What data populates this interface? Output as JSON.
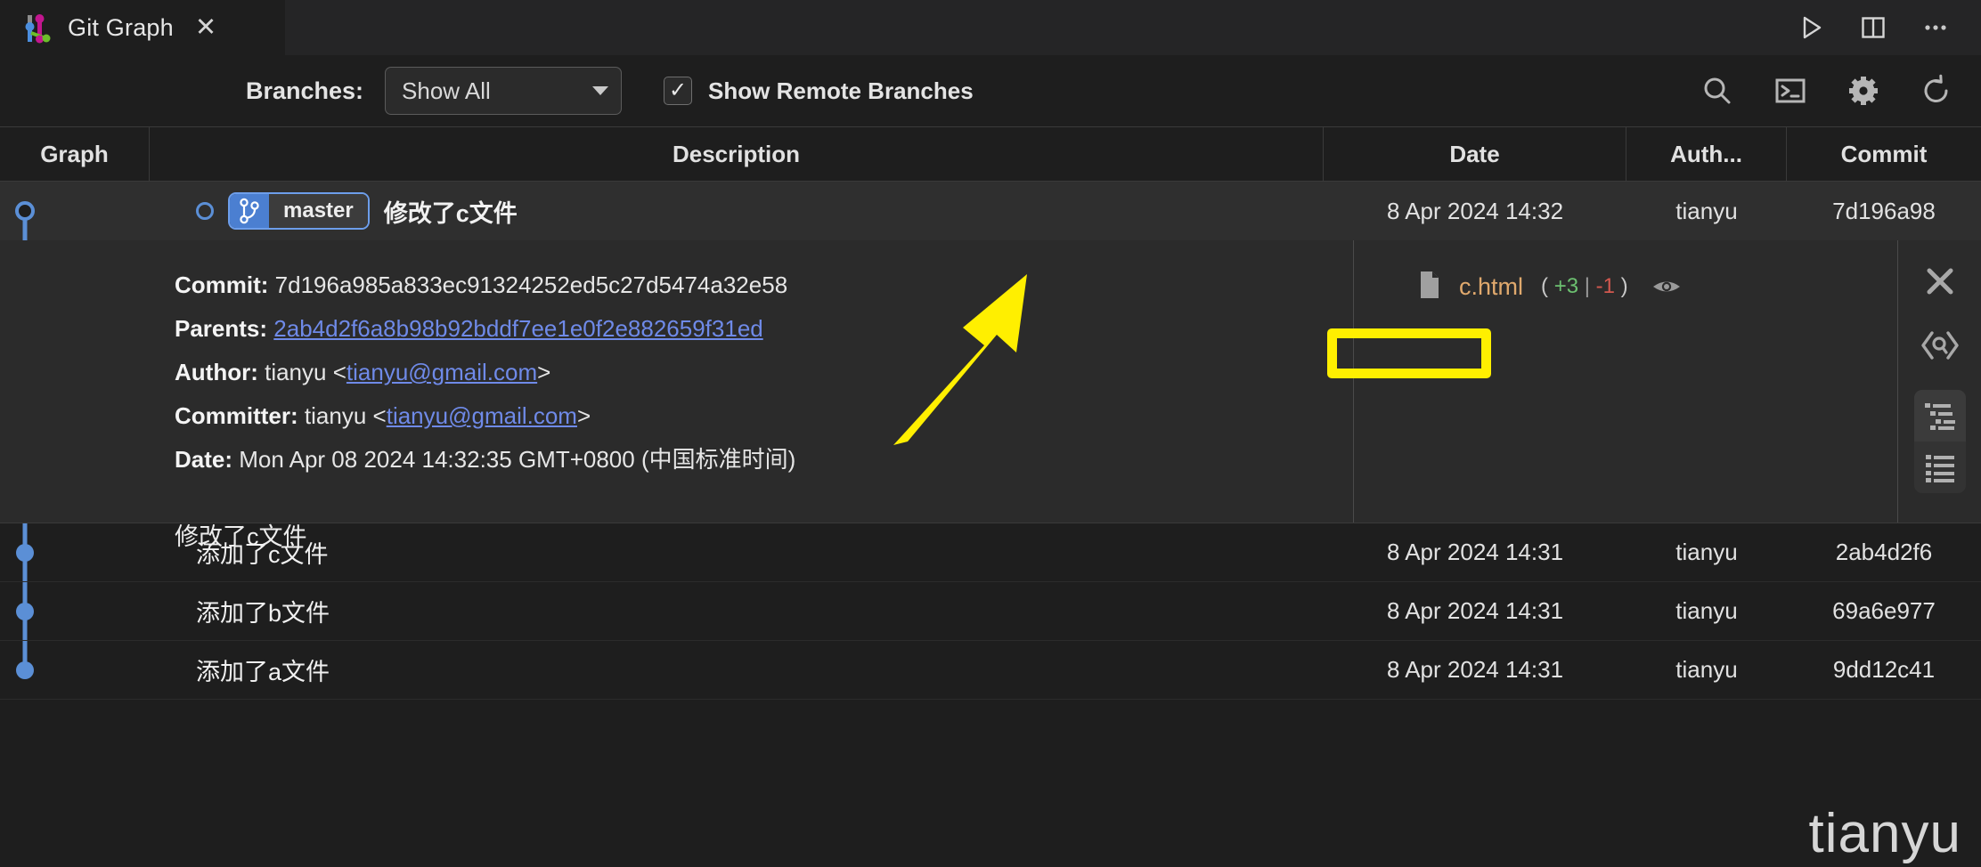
{
  "window": {
    "tab_title": "Git Graph",
    "tab_close_glyph": "✕",
    "actions": [
      {
        "name": "run-icon",
        "label": "Run"
      },
      {
        "name": "split-editor-icon",
        "label": "Split Editor"
      },
      {
        "name": "more-actions-icon",
        "label": "More Actions..."
      }
    ]
  },
  "toolbar": {
    "branches_label": "Branches:",
    "branch_selected": "Show All",
    "show_remote_label": "Show Remote Branches",
    "show_remote_checked": true,
    "checkmark": "✓",
    "actions": [
      {
        "name": "search-icon",
        "label": "Search"
      },
      {
        "name": "terminal-icon",
        "label": "Terminal"
      },
      {
        "name": "gear-icon",
        "label": "Settings"
      },
      {
        "name": "refresh-icon",
        "label": "Refresh"
      }
    ]
  },
  "table": {
    "headers": {
      "graph": "Graph",
      "description": "Description",
      "date": "Date",
      "author": "Auth...",
      "commit": "Commit"
    },
    "rows": [
      {
        "branch_badge": "master",
        "description": "修改了c文件",
        "date": "8 Apr 2024 14:32",
        "author": "tianyu",
        "commit": "7d196a98",
        "selected": true
      },
      {
        "branch_badge": "",
        "description": "添加了c文件",
        "date": "8 Apr 2024 14:31",
        "author": "tianyu",
        "commit": "2ab4d2f6",
        "selected": false
      },
      {
        "branch_badge": "",
        "description": "添加了b文件",
        "date": "8 Apr 2024 14:31",
        "author": "tianyu",
        "commit": "69a6e977",
        "selected": false
      },
      {
        "branch_badge": "",
        "description": "添加了a文件",
        "date": "8 Apr 2024 14:31",
        "author": "tianyu",
        "commit": "9dd12c41",
        "selected": false
      }
    ]
  },
  "detail": {
    "commit_label": "Commit:",
    "commit_hash": "7d196a985a833ec91324252ed5c27d5474a32e58",
    "parents_label": "Parents:",
    "parents_hash": "2ab4d2f6a8b98b92bddf7ee1e0f2e882659f31ed",
    "author_label": "Author:",
    "author_name": "tianyu",
    "author_email": "tianyu@gmail.com",
    "committer_label": "Committer:",
    "committer_name": "tianyu",
    "committer_email": "tianyu@gmail.com",
    "date_label": "Date:",
    "date_value": "Mon Apr 08 2024 14:32:35 GMT+0800 (中国标准时间)",
    "message": "修改了c文件",
    "angle_open": "<",
    "angle_close": ">",
    "files": [
      {
        "name": "c.html",
        "additions": "+3",
        "separator": "|",
        "deletions": "-1",
        "paren_open": "(",
        "paren_close": ")",
        "highlighted": true
      }
    ],
    "actions": [
      {
        "name": "close-icon",
        "label": "Close"
      },
      {
        "name": "code-review-icon",
        "label": "Code Review"
      },
      {
        "name": "file-tree-view-icon",
        "label": "File Tree View"
      },
      {
        "name": "file-list-view-icon",
        "label": "File List View"
      }
    ]
  },
  "annotation": {
    "highlight_color": "#ffef00",
    "arrow_color": "#ffef00",
    "target": "c.html"
  },
  "watermark": "tianyu",
  "colors": {
    "accent_blue": "#5b8fd6",
    "background": "#1e1e1e",
    "panel": "#2b2b2b",
    "link": "#6f8ae8",
    "file_name": "#e0a96d",
    "additions": "#6cc070",
    "deletions": "#d3584f"
  }
}
